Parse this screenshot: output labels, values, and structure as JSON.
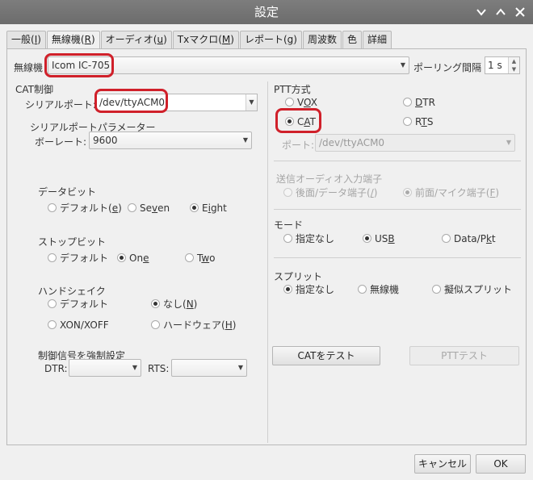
{
  "window": {
    "title": "設定"
  },
  "tabs": [
    {
      "label": "一般(",
      "key": "I",
      "end": ")"
    },
    {
      "label": "無線機(",
      "key": "R",
      "end": ")"
    },
    {
      "label": "オーディオ(",
      "key": "u",
      "end": ")"
    },
    {
      "label": "Txマクロ(",
      "key": "M",
      "end": ")"
    },
    {
      "label": "レポート(",
      "key": "g",
      "end": ")"
    },
    {
      "label": "周波数",
      "key": "",
      "end": ""
    },
    {
      "label": "色",
      "key": "",
      "end": ""
    },
    {
      "label": "詳細",
      "key": "",
      "end": ""
    }
  ],
  "rig": {
    "label": "無線機",
    "value": "Icom IC-705",
    "polling_label": "ポーリング間隔",
    "polling_value": "1 s"
  },
  "cat": {
    "group": "CAT制御",
    "serial_label": "シリアルポート",
    "serial_value": "/dev/ttyACM0",
    "params_group": "シリアルポートパラメーター",
    "baud_label": "ボーレート",
    "baud_value": "9600",
    "databits": {
      "title": "データビット",
      "default": "デフォルト(",
      "default_key": "e",
      "seven_a": "Se",
      "seven_key": "v",
      "seven_b": "en",
      "eight_a": "E",
      "eight_key": "i",
      "eight_b": "ght"
    },
    "stopbits": {
      "title": "ストップビット",
      "default": "デフォルト",
      "one_a": "On",
      "one_key": "e",
      "two_a": "T",
      "two_key": "w",
      "two_b": "o"
    },
    "handshake": {
      "title": "ハンドシェイク",
      "default": "デフォルト",
      "none_a": "なし(",
      "none_key": "N",
      "xon": "XON/XOFF",
      "hw_a": "ハードウェア(",
      "hw_key": "H"
    },
    "force": {
      "title": "制御信号を強制設定",
      "dtr": "DTR:",
      "rts": "RTS:"
    }
  },
  "ptt": {
    "group": "PTT方式",
    "vox_a": "V",
    "vox_key": "O",
    "vox_b": "X",
    "dtr_key": "D",
    "dtr_b": "TR",
    "cat_a": "C",
    "cat_key": "A",
    "cat_b": "T",
    "rts_a": "R",
    "rts_key": "T",
    "rts_b": "S",
    "port_label": "ポート",
    "port_value": "/dev/ttyACM0"
  },
  "tx_audio": {
    "title": "送信オーディオ入力端子",
    "rear_a": "後面/データ端子(",
    "rear_key": "/",
    "front_a": "前面/マイク端子(",
    "front_key": "F"
  },
  "mode": {
    "title": "モード",
    "none": "指定なし",
    "usb_a": "US",
    "usb_key": "B",
    "data_a": "Data/P",
    "data_key": "k",
    "data_b": "t"
  },
  "split": {
    "title": "スプリット",
    "none": "指定なし",
    "rig": "無線機",
    "fake": "擬似スプリット"
  },
  "buttons": {
    "test_cat": "CATをテスト",
    "test_ptt": "PTTテスト",
    "cancel": "キャンセル",
    "ok": "OK"
  },
  "colors": {
    "highlight": "#d0202a",
    "titlebar": "#747474"
  }
}
